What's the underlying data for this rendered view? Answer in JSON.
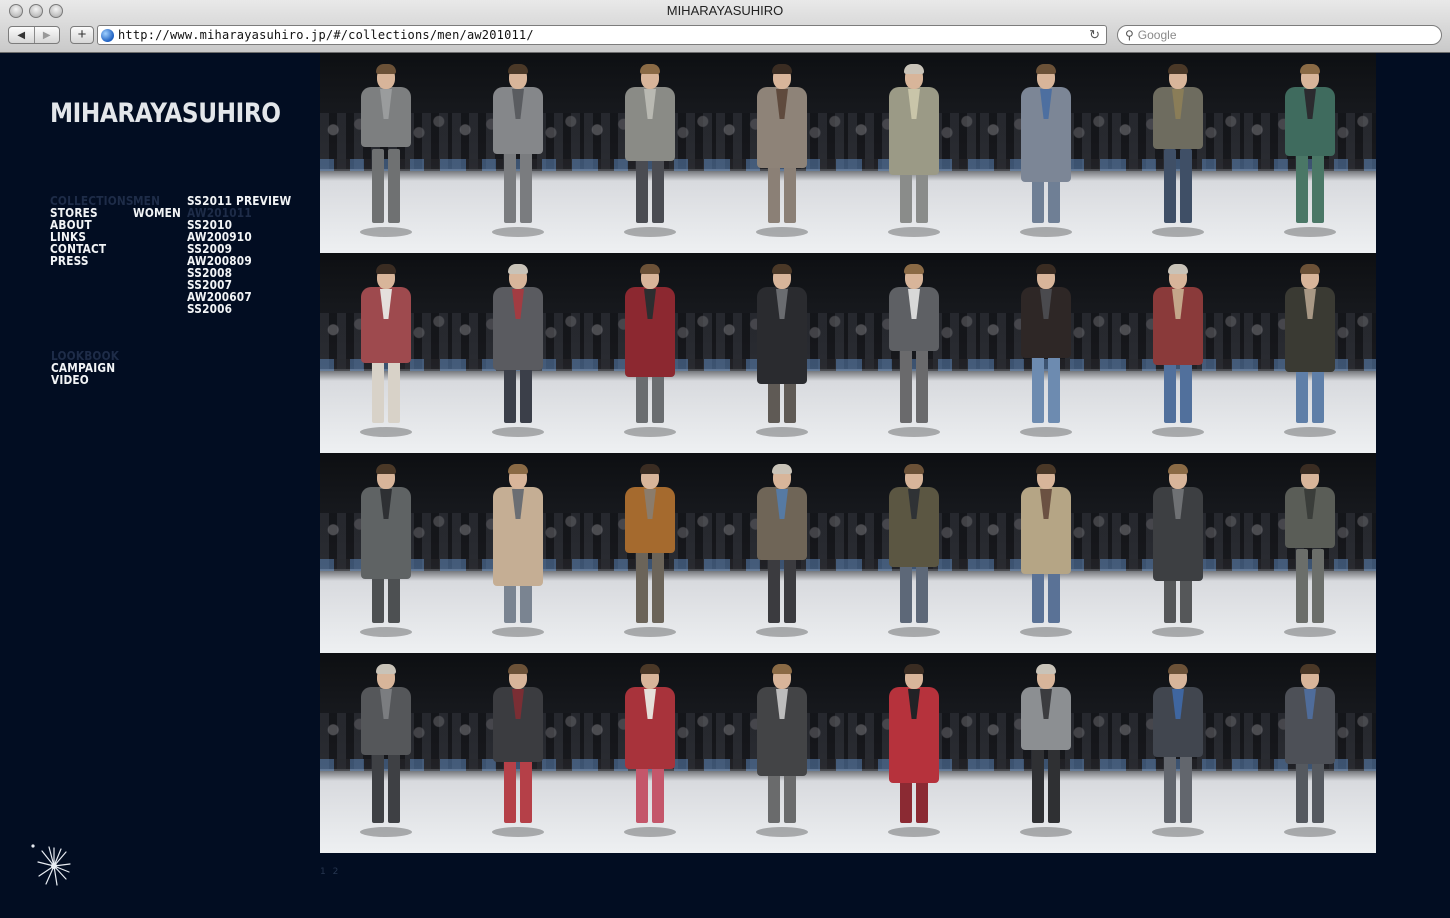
{
  "window": {
    "title": "MIHARAYASUHIRO"
  },
  "browser": {
    "url": "http://www.miharayasuhiro.jp/#/collections/men/aw201011/",
    "search_placeholder": "Google"
  },
  "site": {
    "logo": "MIHARAYASUHIRO",
    "main_menu": [
      "COLLECTIONS",
      "STORES",
      "ABOUT",
      "LINKS",
      "CONTACT",
      "PRESS"
    ],
    "main_menu_active": "COLLECTIONS",
    "gender_menu": [
      "MEN",
      "WOMEN"
    ],
    "gender_menu_active": "MEN",
    "season_menu": [
      "SS2011 PREVIEW",
      "AW201011",
      "SS2010",
      "AW200910",
      "SS2009",
      "AW200809",
      "SS2008",
      "SS2007",
      "AW200607",
      "SS2006"
    ],
    "season_menu_active": "AW201011",
    "extra_menu": [
      "LOOKBOOK",
      "CAMPAIGN",
      "VIDEO"
    ],
    "extra_menu_dim": "LOOKBOOK",
    "pagination": [
      "1",
      "2"
    ]
  },
  "looks": [
    {
      "coat": "#7d7f80",
      "pants": "#6f7172",
      "inner": "#9a9c9d"
    },
    {
      "coat": "#85878a",
      "pants": "#7a7c7f",
      "inner": "#5a5c60"
    },
    {
      "coat": "#8a8b86",
      "pants": "#4a4c52",
      "inner": "#b9b9b2"
    },
    {
      "coat": "#8e8378",
      "pants": "#8b8076",
      "inner": "#5f4a3d"
    },
    {
      "coat": "#9b9a86",
      "pants": "#8a8c8a",
      "inner": "#c9c5a9"
    },
    {
      "coat": "#7c8696",
      "pants": "#6f7f95",
      "inner": "#4d6fa0"
    },
    {
      "coat": "#6e6c5f",
      "pants": "#3f4f66",
      "inner": "#8a7d58"
    },
    {
      "coat": "#3f6b5e",
      "pants": "#4a7766",
      "inner": "#2b2b2f"
    },
    {
      "coat": "#9e4a4e",
      "pants": "#d8d2c8",
      "inner": "#e4e0dc"
    },
    {
      "coat": "#5a5b60",
      "pants": "#3b3f49",
      "inner": "#a23c42"
    },
    {
      "coat": "#8c2830",
      "pants": "#6a6d70",
      "inner": "#2c2d2f"
    },
    {
      "coat": "#2a2b2f",
      "pants": "#5f5a55",
      "inner": "#6a6c70"
    },
    {
      "coat": "#5e6064",
      "pants": "#6a6a6c",
      "inner": "#d8d8d8"
    },
    {
      "coat": "#2e2726",
      "pants": "#6d8bb0",
      "inner": "#4a4a4e"
    },
    {
      "coat": "#8a3a3a",
      "pants": "#51709c",
      "inner": "#c4a68a"
    },
    {
      "coat": "#3a3a33",
      "pants": "#5f7fa8",
      "inner": "#a89885"
    },
    {
      "coat": "#5f6364",
      "pants": "#4d5052",
      "inner": "#2e3033"
    },
    {
      "coat": "#c5ae94",
      "pants": "#7a8491",
      "inner": "#6b6e73"
    },
    {
      "coat": "#a56a2e",
      "pants": "#6b6459",
      "inner": "#8b7c6b"
    },
    {
      "coat": "#6f6557",
      "pants": "#3b3b3f",
      "inner": "#567aa3"
    },
    {
      "coat": "#5b5642",
      "pants": "#5d6878",
      "inner": "#2f3235"
    },
    {
      "coat": "#b5a585",
      "pants": "#5a7296",
      "inner": "#6b5142"
    },
    {
      "coat": "#3d3f42",
      "pants": "#555759",
      "inner": "#6f7174"
    },
    {
      "coat": "#5a5d57",
      "pants": "#6b6e6a",
      "inner": "#3a3d3a"
    },
    {
      "coat": "#55575a",
      "pants": "#3e4044",
      "inner": "#7b7d80"
    },
    {
      "coat": "#3b3c40",
      "pants": "#b54048",
      "inner": "#7a2e34"
    },
    {
      "coat": "#a8333b",
      "pants": "#c4566a",
      "inner": "#e6dfd9"
    },
    {
      "coat": "#434446",
      "pants": "#6a6b6c",
      "inner": "#bdbdbd"
    },
    {
      "coat": "#b6323c",
      "pants": "#8b2a33",
      "inner": "#222226"
    },
    {
      "coat": "#8c8f92",
      "pants": "#2f3033",
      "inner": "#3b3c3f"
    },
    {
      "coat": "#41464f",
      "pants": "#62666d",
      "inner": "#3f66a0"
    },
    {
      "coat": "#4d5057",
      "pants": "#55595f",
      "inner": "#4f6c9a"
    }
  ]
}
